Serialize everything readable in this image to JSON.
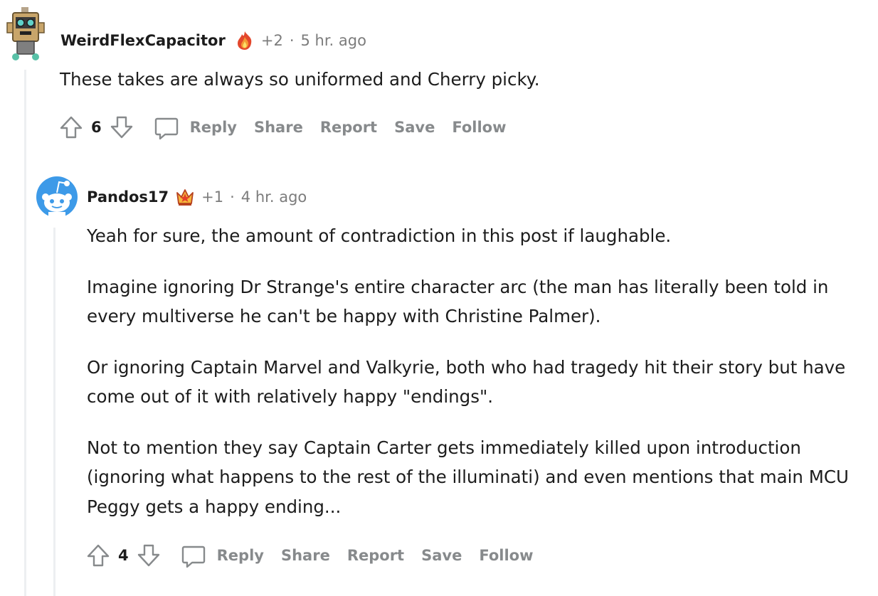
{
  "comments": [
    {
      "username": "WeirdFlexCapacitor",
      "award_count": "+2",
      "separator": "·",
      "timestamp": "5 hr. ago",
      "paragraphs": [
        "These takes are always so uniformed and Cherry picky."
      ],
      "score": "6",
      "actions": {
        "reply": "Reply",
        "share": "Share",
        "report": "Report",
        "save": "Save",
        "follow": "Follow"
      }
    },
    {
      "username": "Pandos17",
      "award_count": "+1",
      "separator": "·",
      "timestamp": "4 hr. ago",
      "paragraphs": [
        "Yeah for sure, the amount of contradiction in this post if laughable.",
        "Imagine ignoring Dr Strange's entire character arc (the man has literally been told in every multiverse he can't be happy with Christine Palmer).",
        "Or ignoring Captain Marvel and Valkyrie, both who had tragedy hit their story but have come out of it with relatively happy \"endings\".",
        "Not to mention they say Captain Carter gets immediately killed upon introduction (ignoring what happens to the rest of the illuminati) and even mentions that main MCU Peggy gets a happy ending..."
      ],
      "score": "4",
      "actions": {
        "reply": "Reply",
        "share": "Share",
        "report": "Report",
        "save": "Save",
        "follow": "Follow"
      }
    }
  ],
  "colors": {
    "meta_gray": "#7c7c7c",
    "action_gray": "#878a8c",
    "thread_line": "#edeff1",
    "text": "#1c1c1c"
  },
  "icons": [
    "upvote-icon",
    "downvote-icon",
    "comment-bubble-icon",
    "fire-award-icon",
    "crown-award-icon"
  ]
}
